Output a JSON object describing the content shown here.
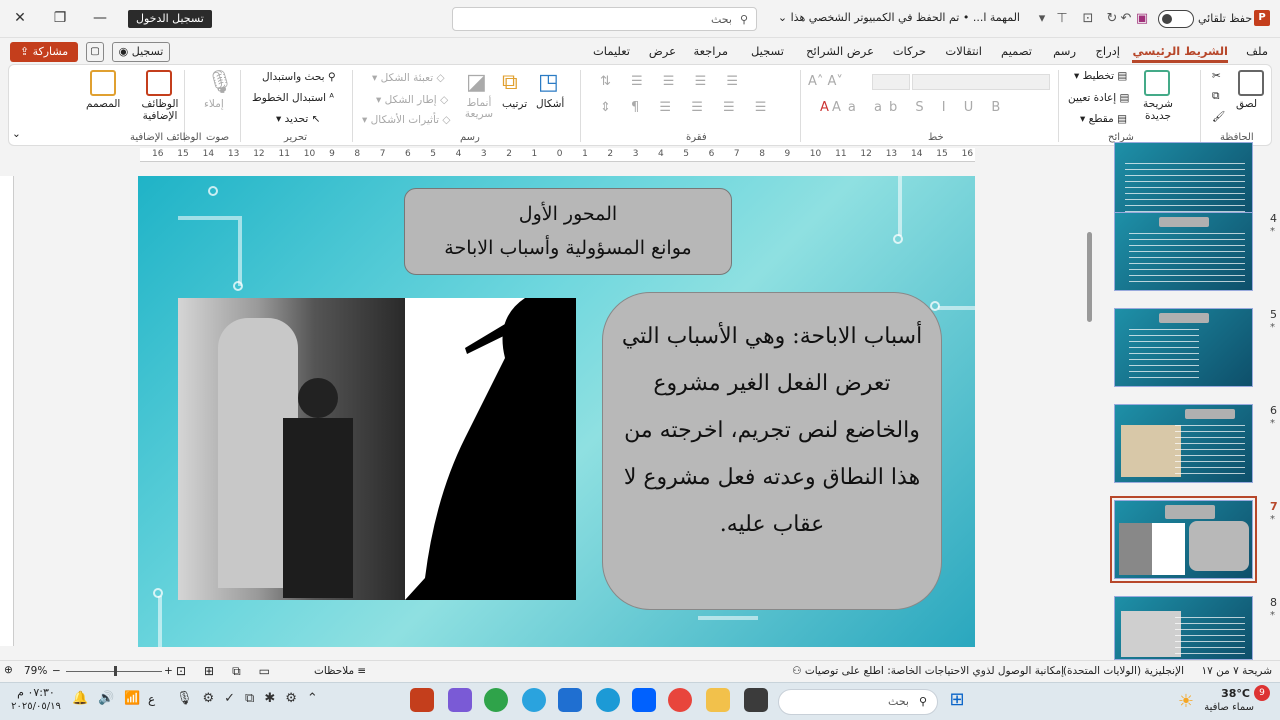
{
  "titlebar": {
    "login_label": "تسجيل الدخول",
    "search_placeholder": "بحث",
    "document_title": "المهمة ا... • تم الحفظ في الكمبيوتر الشخصي هذا",
    "autosave_label": "حفظ تلقائي"
  },
  "tabs": [
    "ملف",
    "الشريط الرئيسي",
    "إدراج",
    "رسم",
    "تصميم",
    "انتقالات",
    "حركات",
    "عرض الشرائح",
    "تسجيل",
    "مراجعة",
    "عرض",
    "تعليمات"
  ],
  "share_label": "مشاركة",
  "record_label": "تسجيل",
  "ribbon": {
    "clipboard": {
      "paste": "لصق",
      "group": "الحافظة"
    },
    "slides": {
      "new_slide": "شريحة جديدة",
      "layout": "تخطيط",
      "reset": "إعادة تعيين",
      "section": "مقطع",
      "group": "شرائح"
    },
    "font": {
      "group": "خط"
    },
    "paragraph": {
      "group": "فقرة"
    },
    "drawing": {
      "shapes": "أشكال",
      "arrange": "ترتيب",
      "quick_styles": "أنماط سريعة",
      "fill": "تعبئة الشكل",
      "outline": "إطار الشكل",
      "effects": "تأثيرات الأشكال",
      "group": "رسم"
    },
    "editing": {
      "find": "بحث واستبدال",
      "replace": "استبدال الخطوط",
      "select": "تحديد",
      "group": "تحرير"
    },
    "voice": {
      "dictate": "إملاء",
      "group": "صوت"
    },
    "addins": {
      "addins": "الوظائف الإضافية",
      "designer": "المصمم",
      "group": "الوظائف الإضافية"
    }
  },
  "ruler_numbers": [
    "16",
    "15",
    "14",
    "13",
    "12",
    "11",
    "10",
    "9",
    "8",
    "7",
    "6",
    "5",
    "4",
    "3",
    "2",
    "1",
    "0",
    "1",
    "2",
    "3",
    "4",
    "5",
    "6",
    "7",
    "8",
    "9",
    "10",
    "11",
    "12",
    "13",
    "14",
    "15",
    "16"
  ],
  "slide": {
    "title_line1": "المحور الأول",
    "title_line2": "موانع المسؤولية وأسباب الاباحة",
    "body": "أسباب الاباحة: وهي الأسباب التي تعرض الفعل الغير مشروع والخاضع لنص تجريم، اخرجته من هذا النطاق وعدته فعل مشروع لا عقاب عليه."
  },
  "thumbnails": [
    {
      "num": "4",
      "title": "الأهداف السلوكية"
    },
    {
      "num": "5",
      "title": "محاور الدرس"
    },
    {
      "num": "6",
      "title": "المقدمة"
    },
    {
      "num": "7",
      "title": "المحور الأول"
    },
    {
      "num": "8",
      "title": ""
    }
  ],
  "statusbar": {
    "slide_info": "شريحة ٧ من ١٧",
    "language": "الإنجليزية (الولايات المتحدة)",
    "accessibility": "إمكانية الوصول لذوي الاحتياجات الخاصة: اطلع على توصيات",
    "notes": "ملاحظات",
    "zoom": "79%"
  },
  "taskbar": {
    "search": "بحث",
    "time": "٠٧:٣٠ م",
    "date": "٢٠٢٥/٠٥/١٩",
    "weather_temp": "38°C",
    "weather_desc": "سماء صافية",
    "lang": "ع",
    "weather_badge": "9"
  }
}
